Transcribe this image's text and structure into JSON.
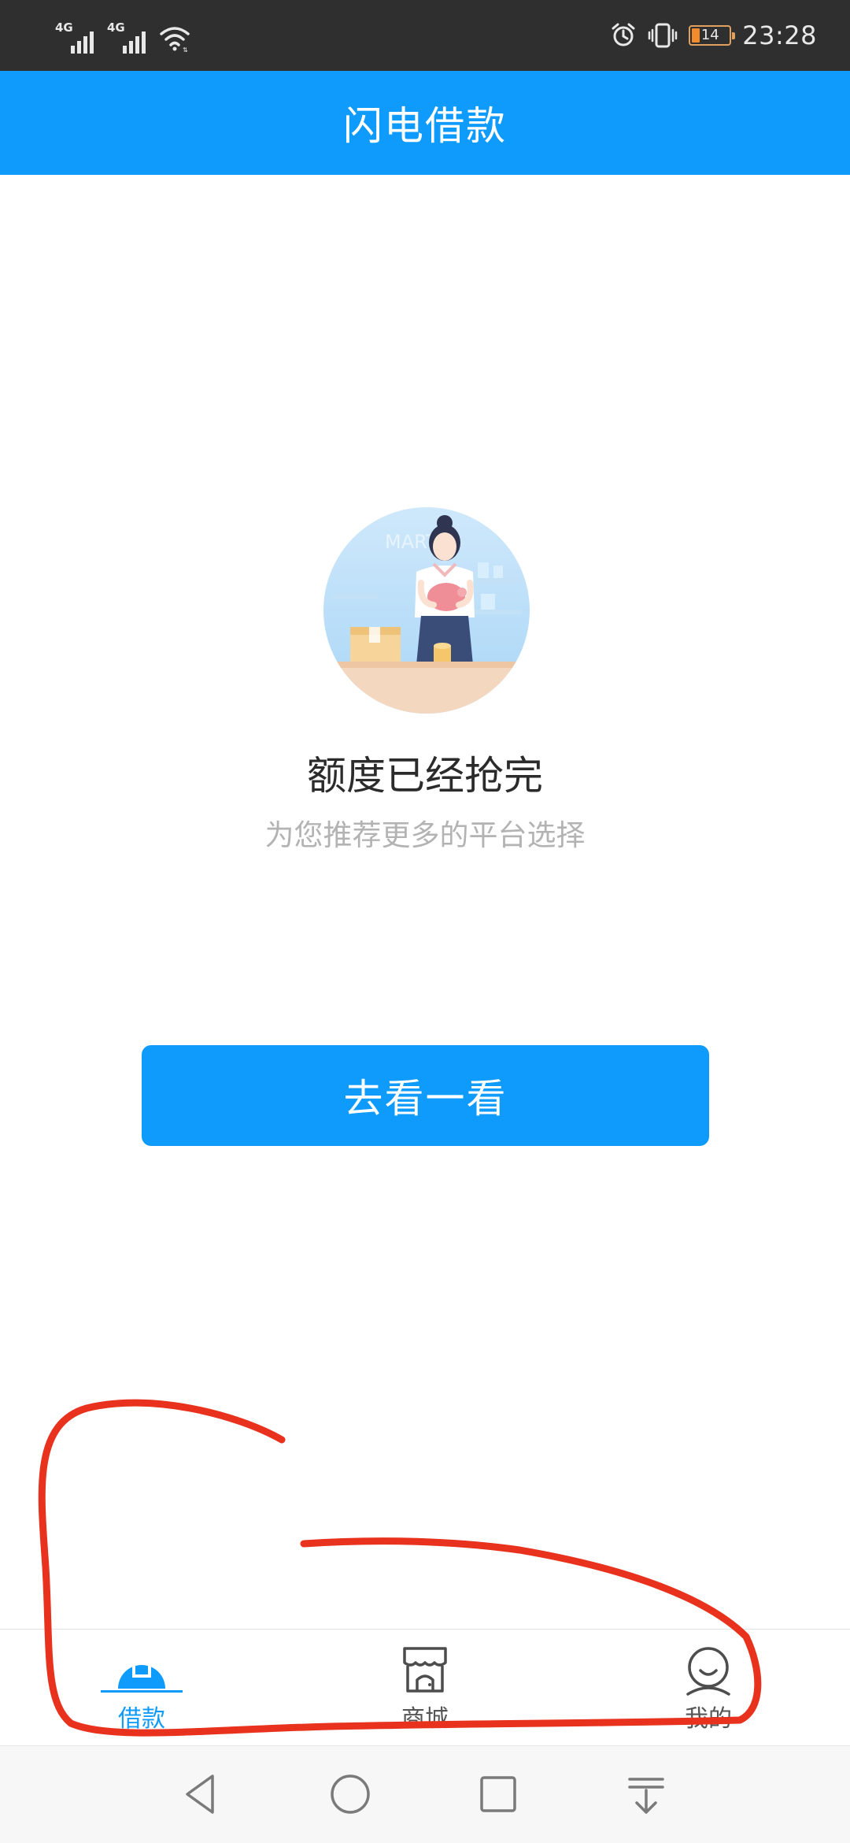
{
  "status_bar": {
    "network_1": "4G",
    "network_2": "4G",
    "battery_level": "14",
    "time": "23:28",
    "icons": [
      "signal-icon",
      "signal-icon",
      "wifi-icon",
      "alarm-icon",
      "vibrate-icon",
      "battery-icon"
    ]
  },
  "header": {
    "title": "闪电借款"
  },
  "main": {
    "illustration_icon": "shopkeeper-illustration",
    "empty_title": "额度已经抢完",
    "empty_subtitle": "为您推荐更多的平台选择",
    "cta_label": "去看一看"
  },
  "bottom_nav": {
    "items": [
      {
        "label": "借款",
        "icon": "loan-icon",
        "active": true
      },
      {
        "label": "商城",
        "icon": "store-icon",
        "active": false
      },
      {
        "label": "我的",
        "icon": "profile-icon",
        "active": false
      }
    ]
  },
  "system_nav": {
    "icons": [
      "back-icon",
      "home-icon",
      "recents-icon",
      "notification-pull-icon"
    ]
  },
  "colors": {
    "accent": "#0f9bfb",
    "status_bar": "#2f2f2f",
    "annotation": "#e8321e",
    "title_text": "#2b2b2b",
    "subtitle_text": "#b3b3b3"
  }
}
